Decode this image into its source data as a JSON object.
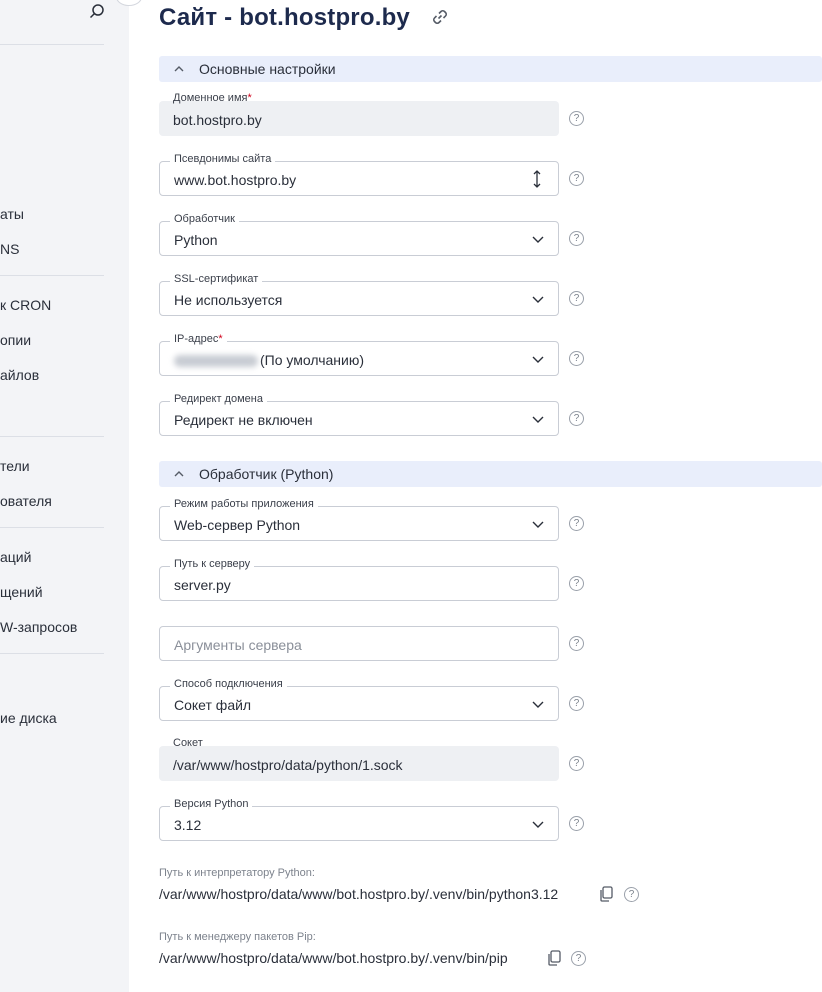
{
  "page": {
    "title": "Сайт - bot.hostpro.by"
  },
  "sidebar": {
    "items": [
      "аты",
      "NS",
      "к CRON",
      "опии",
      "айлов",
      "тели",
      "ователя",
      "аций",
      "щений",
      "W-запросов",
      "ие диска"
    ]
  },
  "sections": {
    "main": "Основные настройки",
    "handler": "Обработчик (Python)"
  },
  "fields": {
    "domain": {
      "label": "Доменное имя",
      "required": "*",
      "value": "bot.hostpro.by"
    },
    "aliases": {
      "label": "Псевдонимы сайта",
      "value": "www.bot.hostpro.by"
    },
    "handler": {
      "label": "Обработчик",
      "value": "Python"
    },
    "ssl": {
      "label": "SSL-сертификат",
      "value": "Не используется"
    },
    "ip": {
      "label": "IP-адрес",
      "required": "*",
      "value": "(По умолчанию)"
    },
    "redirect": {
      "label": "Редирект домена",
      "value": "Редирект не включен"
    },
    "app_mode": {
      "label": "Режим работы приложения",
      "value": "Web-сервер Python"
    },
    "server_path": {
      "label": "Путь к серверу",
      "value": "server.py"
    },
    "server_args": {
      "placeholder": "Аргументы сервера"
    },
    "connection": {
      "label": "Способ подключения",
      "value": "Сокет файл"
    },
    "socket": {
      "label": "Сокет",
      "value": "/var/www/hostpro/data/python/1.sock"
    },
    "python_version": {
      "label": "Версия Python",
      "value": "3.12"
    }
  },
  "paths": {
    "interpreter": {
      "label": "Путь к интерпретатору Python:",
      "value": "/var/www/hostpro/data/www/bot.hostpro.by/.venv/bin/python3.12"
    },
    "pip": {
      "label": "Путь к менеджеру пакетов Pip:",
      "value": "/var/www/hostpro/data/www/bot.hostpro.by/.venv/bin/pip"
    }
  },
  "help_glyph": "?",
  "colors": {
    "accent_section_bg": "#e9eefb",
    "required": "#d0021b",
    "title": "#1d2a4d"
  }
}
